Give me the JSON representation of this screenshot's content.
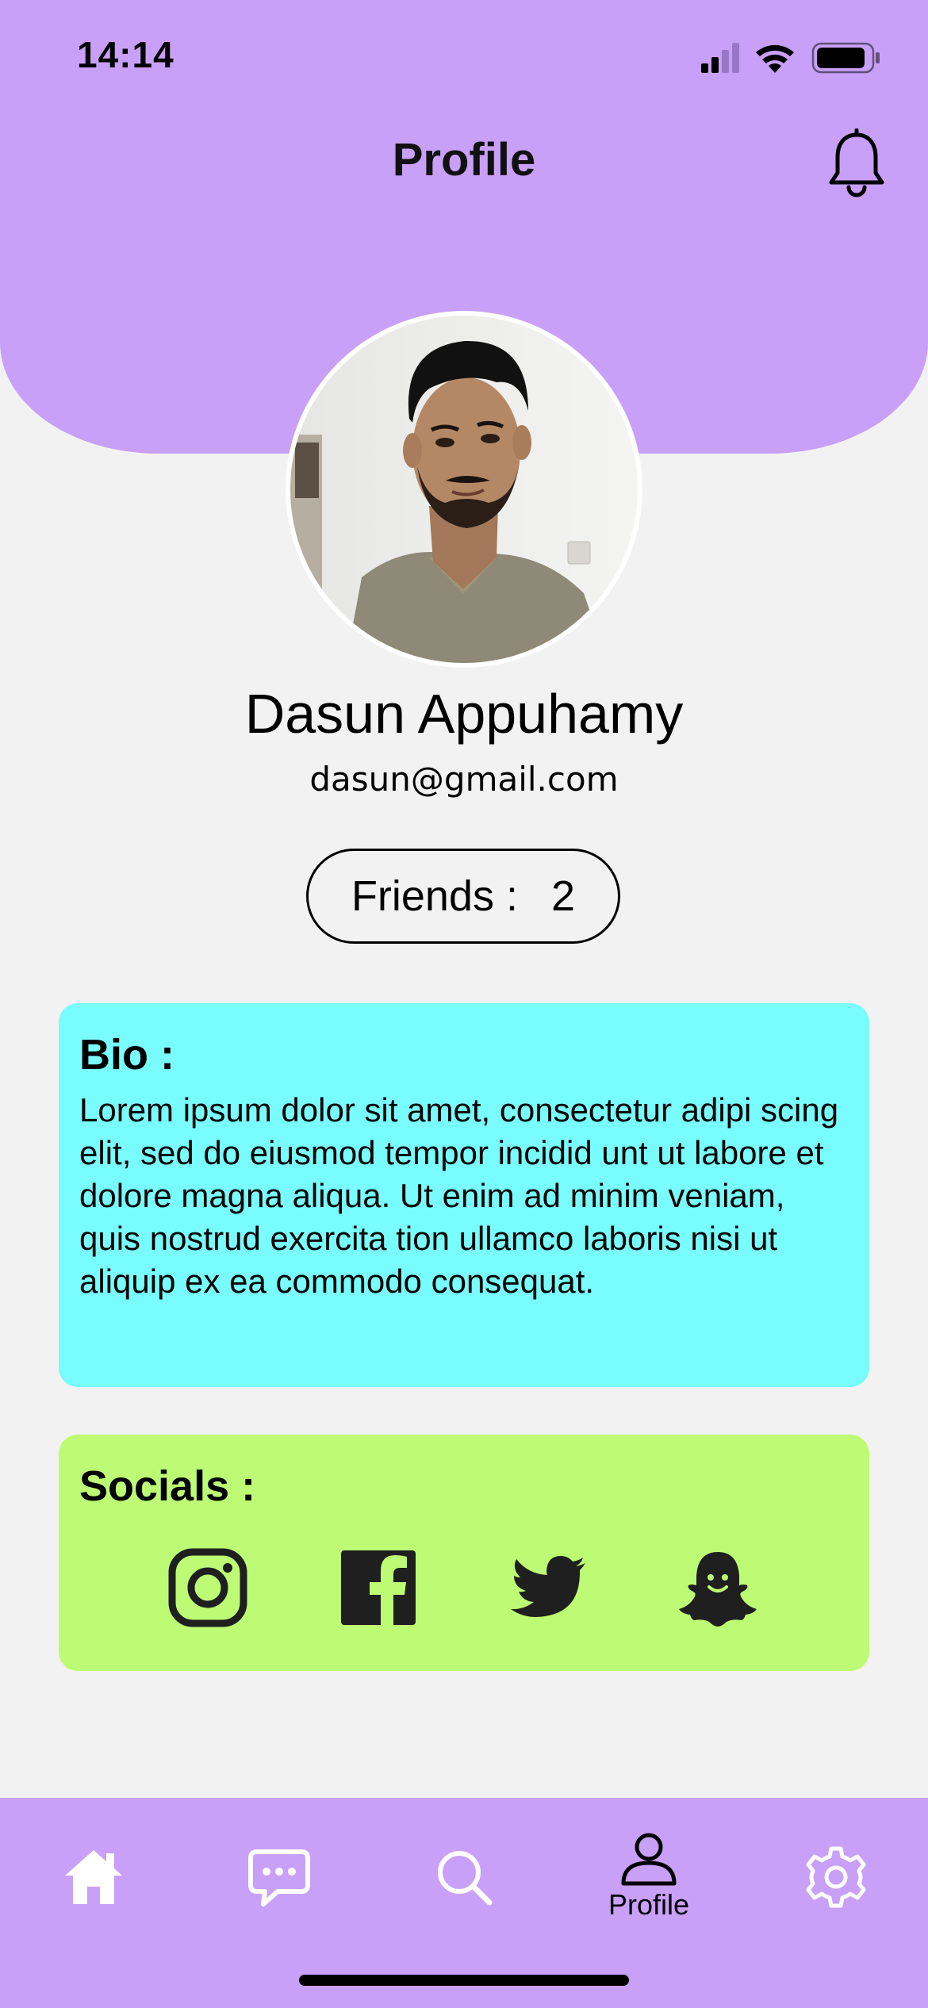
{
  "status_bar": {
    "time": "14:14"
  },
  "header": {
    "title": "Profile"
  },
  "profile": {
    "name": "Dasun Appuhamy",
    "email": "dasun@gmail.com",
    "friends_label": "Friends :",
    "friends_count": "2"
  },
  "bio": {
    "title": "Bio :",
    "text": "Lorem ipsum dolor sit amet, consectetur adipi scing elit, sed do eiusmod tempor incidid unt ut labore et dolore magna aliqua. Ut enim ad minim veniam, quis nostrud exercita tion ullamco laboris nisi ut aliquip ex ea commodo consequat."
  },
  "socials": {
    "title": "Socials :",
    "items": [
      {
        "icon": "instagram-icon"
      },
      {
        "icon": "facebook-icon"
      },
      {
        "icon": "twitter-icon"
      },
      {
        "icon": "snapchat-icon"
      }
    ]
  },
  "bottom_nav": {
    "items": [
      {
        "icon": "home-icon",
        "label": ""
      },
      {
        "icon": "chat-icon",
        "label": ""
      },
      {
        "icon": "search-icon",
        "label": ""
      },
      {
        "icon": "profile-icon",
        "label": "Profile",
        "active": true
      },
      {
        "icon": "settings-icon",
        "label": ""
      }
    ]
  },
  "colors": {
    "header_purple": "#c9a0f7",
    "background": "#f2f2f2",
    "bio_card": "#78fcfd",
    "socials_card": "#bdfb74"
  }
}
